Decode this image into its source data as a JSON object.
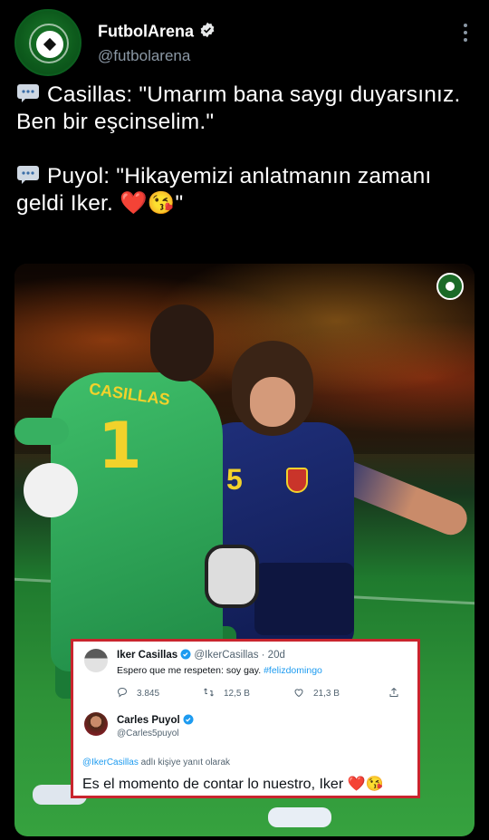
{
  "account": {
    "name": "FutbolArena",
    "handle": "@futbolarena"
  },
  "tweet": {
    "line1": "Casillas: \"Umarım bana saygı duyarsınız. Ben bir eşcinselim.\"",
    "line2": "Puyol: \"Hikayemizi anlatmanın zamanı geldi Iker. ❤️😘\""
  },
  "embedded": {
    "tweet1": {
      "name": "Iker Casillas",
      "handle": "@IkerCasillas",
      "age": "· 20d",
      "text": "Espero que me respeten: soy gay.",
      "hashtag": "#felizdomingo",
      "replies": "3.845",
      "retweets": "12,5 B",
      "likes": "21,3 B"
    },
    "tweet2": {
      "name": "Carles Puyol",
      "handle": "@Carles5puyol",
      "reply_handle": "@IkerCasillas",
      "reply_suffix": "adlı kişiye yanıt olarak",
      "text": "Es el momento de contar lo nuestro, Iker ❤️😘"
    }
  },
  "photo": {
    "gk_shirt_name": "CASILLAS",
    "gk_number": "1",
    "cp_number": "5"
  },
  "colors": {
    "background": "#000000",
    "muted": "#8b98a5",
    "verified": "#1d9bf0",
    "card_border": "#c9252e"
  },
  "icons": [
    "speech-bubble-icon",
    "verified-badge-icon",
    "more-icon",
    "reply-icon",
    "retweet-icon",
    "like-icon",
    "share-icon"
  ]
}
